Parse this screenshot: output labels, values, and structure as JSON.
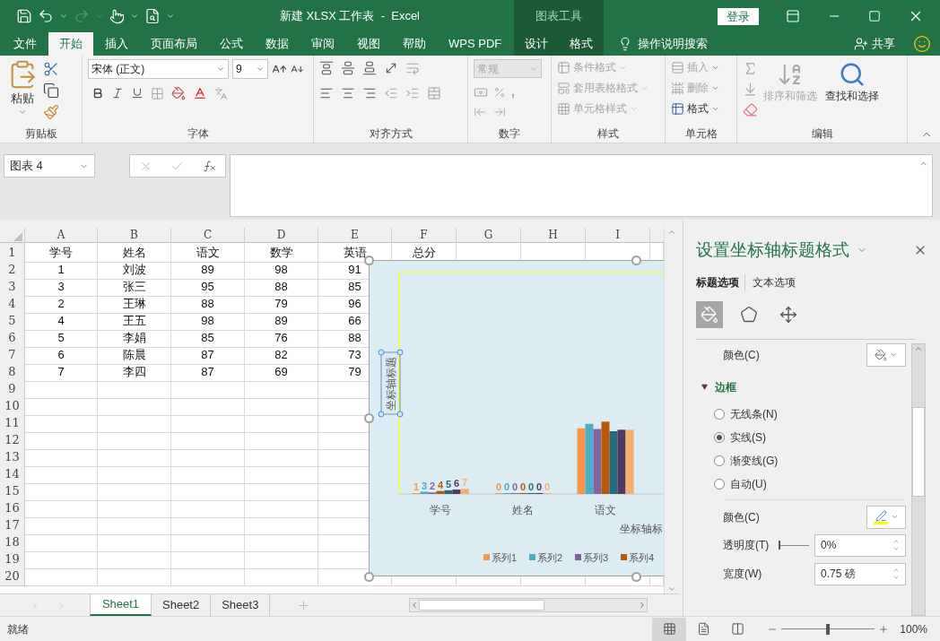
{
  "title_bar": {
    "title": "新建 XLSX 工作表  -  Excel",
    "context_label": "图表工具",
    "login": "登录"
  },
  "ribbon_tabs": [
    {
      "label": "文件",
      "selected": false,
      "contextual": false
    },
    {
      "label": "开始",
      "selected": true,
      "contextual": false
    },
    {
      "label": "插入",
      "selected": false,
      "contextual": false
    },
    {
      "label": "页面布局",
      "selected": false,
      "contextual": false
    },
    {
      "label": "公式",
      "selected": false,
      "contextual": false
    },
    {
      "label": "数据",
      "selected": false,
      "contextual": false
    },
    {
      "label": "审阅",
      "selected": false,
      "contextual": false
    },
    {
      "label": "视图",
      "selected": false,
      "contextual": false
    },
    {
      "label": "帮助",
      "selected": false,
      "contextual": false
    },
    {
      "label": "WPS PDF",
      "selected": false,
      "contextual": false
    },
    {
      "label": "设计",
      "selected": false,
      "contextual": true
    },
    {
      "label": "格式",
      "selected": false,
      "contextual": true
    }
  ],
  "tell_me": "操作说明搜索",
  "share": "共享",
  "ribbon": {
    "clipboard": {
      "label": "剪贴板",
      "paste": "粘贴"
    },
    "font": {
      "label": "字体",
      "name": "宋体 (正文)",
      "size": "9"
    },
    "alignment": {
      "label": "对齐方式"
    },
    "number": {
      "label": "数字",
      "format": "常规",
      "disabled": true,
      "comma": ","
    },
    "styles": {
      "label": "样式",
      "items": [
        {
          "label": "条件格式",
          "disabled": true
        },
        {
          "label": "套用表格格式",
          "disabled": true
        },
        {
          "label": "单元格样式",
          "disabled": true
        }
      ]
    },
    "cells": {
      "label": "单元格",
      "items": [
        {
          "label": "插入",
          "disabled": true
        },
        {
          "label": "删除",
          "disabled": true
        },
        {
          "label": "格式",
          "disabled": false
        }
      ]
    },
    "editing": {
      "label": "编辑",
      "sort": {
        "label": "排序和筛选",
        "disabled": true
      },
      "find": {
        "label": "查找和选择",
        "disabled": false
      }
    }
  },
  "formula_bar": {
    "name_box": "图表 4"
  },
  "sheet": {
    "columns": [
      "A",
      "B",
      "C",
      "D",
      "E",
      "F",
      "G",
      "H",
      "I"
    ],
    "rows": [
      {
        "header": "1",
        "cells": [
          "学号",
          "姓名",
          "语文",
          "数学",
          "英语",
          "总分"
        ]
      },
      {
        "header": "2",
        "cells": [
          "1",
          "刘波",
          "89",
          "98",
          "91"
        ]
      },
      {
        "header": "3",
        "cells": [
          "3",
          "张三",
          "95",
          "88",
          "85"
        ]
      },
      {
        "header": "4",
        "cells": [
          "2",
          "王琳",
          "88",
          "79",
          "96"
        ]
      },
      {
        "header": "5",
        "cells": [
          "4",
          "王五",
          "98",
          "89",
          "66"
        ]
      },
      {
        "header": "6",
        "cells": [
          "5",
          "李娟",
          "85",
          "76",
          "88"
        ]
      },
      {
        "header": "7",
        "cells": [
          "6",
          "陈晨",
          "87",
          "82",
          "73"
        ]
      },
      {
        "header": "8",
        "cells": [
          "7",
          "李四",
          "87",
          "69",
          "79"
        ]
      },
      {
        "header": "9"
      },
      {
        "header": "10"
      },
      {
        "header": "11"
      },
      {
        "header": "12"
      },
      {
        "header": "13"
      },
      {
        "header": "14"
      },
      {
        "header": "15"
      },
      {
        "header": "16"
      },
      {
        "header": "17"
      },
      {
        "header": "18"
      },
      {
        "header": "19"
      },
      {
        "header": "20"
      }
    ]
  },
  "chart": {
    "vertical_axis_title": "坐标轴标题",
    "horizontal_axis_title": "坐标轴标",
    "chart_data": {
      "type": "bar",
      "categories": [
        "学号",
        "姓名",
        "语文"
      ],
      "ylim": [
        0,
        300
      ],
      "legend": true,
      "series": [
        {
          "name": "系列1",
          "color": "#f79646",
          "values": [
            1,
            0,
            89
          ],
          "value_labels": [
            "1",
            "0",
            null
          ]
        },
        {
          "name": "系列2",
          "color": "#4bacc6",
          "values": [
            3,
            0,
            95
          ],
          "value_labels": [
            "3",
            "0",
            null
          ]
        },
        {
          "name": "系列3",
          "color": "#8064a2",
          "values": [
            2,
            0,
            88
          ],
          "value_labels": [
            "2",
            "0",
            null
          ]
        },
        {
          "name": "系列4",
          "color": "#b85a0a",
          "values": [
            4,
            0,
            98
          ],
          "value_labels": [
            "4",
            "0",
            null
          ]
        },
        {
          "color": "#276a7c",
          "values": [
            5,
            0,
            85
          ],
          "value_labels": [
            "5",
            "0",
            null
          ]
        },
        {
          "color": "#4f3a62",
          "values": [
            6,
            0,
            87
          ],
          "value_labels": [
            "6",
            "0",
            null
          ]
        },
        {
          "color": "#f9ad6f",
          "values": [
            7,
            0,
            87
          ],
          "value_labels": [
            "7",
            "0",
            null
          ]
        }
      ]
    }
  },
  "sheet_tabs": [
    {
      "label": "Sheet1",
      "selected": true
    },
    {
      "label": "Sheet2",
      "selected": false
    },
    {
      "label": "Sheet3",
      "selected": false
    }
  ],
  "status_bar": {
    "status": "就绪",
    "views": [
      {
        "kind": "normal",
        "selected": true
      },
      {
        "kind": "page_layout",
        "selected": false
      },
      {
        "kind": "page_break",
        "selected": false
      }
    ],
    "zoom": {
      "level": 0.5,
      "reading": "100%"
    }
  },
  "panel": {
    "title": "设置坐标轴标题格式",
    "tabs": [
      {
        "label": "标题选项",
        "selected": true
      },
      {
        "label": "文本选项",
        "selected": false
      }
    ],
    "icon_tabs": [
      {
        "kind": "fill_line",
        "selected": true
      },
      {
        "kind": "effects",
        "selected": false
      },
      {
        "kind": "size",
        "selected": false
      }
    ],
    "fill_color_label": "颜色(C)",
    "border": {
      "label": "边框",
      "expanded": true,
      "options": [
        {
          "label": "无线条(N)",
          "selected": false
        },
        {
          "label": "实线(S)",
          "selected": true
        },
        {
          "label": "渐变线(G)",
          "selected": false
        },
        {
          "label": "自动(U)",
          "selected": false
        }
      ],
      "color_label": "颜色(C)",
      "color": "#ffff00",
      "transparency": {
        "label": "透明度(T)",
        "level": 0,
        "value": "0%"
      },
      "width": {
        "label": "宽度(W)",
        "value": "0.75 磅"
      }
    }
  }
}
